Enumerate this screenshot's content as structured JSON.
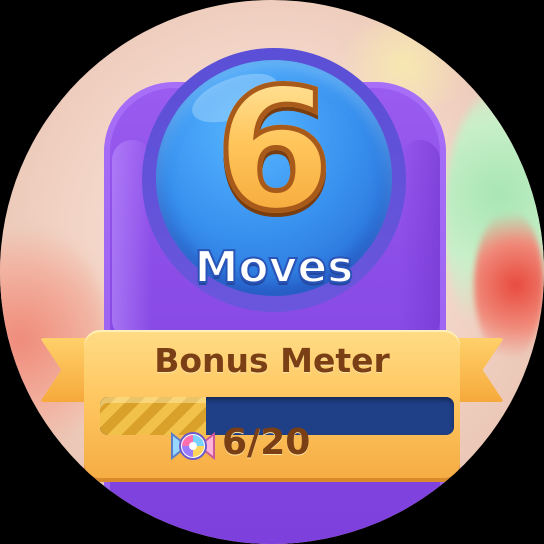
{
  "moves": {
    "count": "6",
    "label": "Moves"
  },
  "bonus_meter": {
    "title": "Bonus Meter",
    "count_text": "6/20",
    "current": 6,
    "max": 20,
    "icon": "candy-icon"
  },
  "colors": {
    "panel": "#8d4ee8",
    "moves_circle": "#3a93f0",
    "number": "#ffc65c",
    "ribbon": "#ffc761",
    "meter_track": "#1f3f86",
    "meter_fill": "#f2c14a",
    "text_brown": "#7a3f14"
  }
}
